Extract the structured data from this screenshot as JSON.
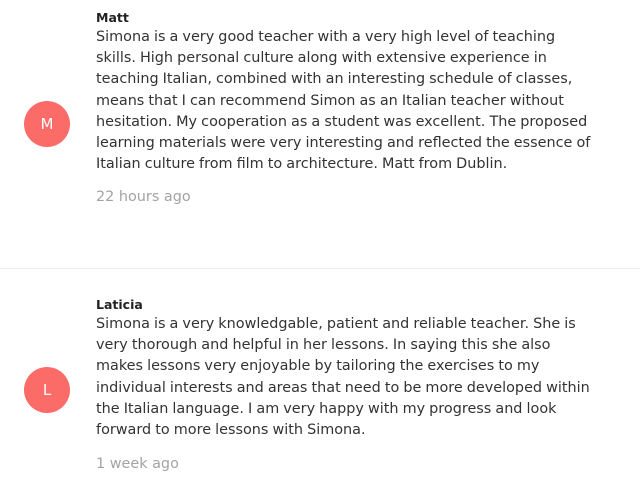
{
  "reviews": [
    {
      "avatar_letter": "M",
      "avatar_color": "#fb6b68",
      "name": "Matt",
      "text": "Simona is a very good teacher with a very high level of teaching skills. High personal culture along with extensive experience in teaching Italian, combined with an interesting schedule of classes, means that I can recommend Simon as an Italian teacher without hesitation. My cooperation as a student was excellent. The proposed learning materials were very interesting and reflected the essence of Italian culture from film to architecture. Matt from Dublin.",
      "time": "22 hours ago"
    },
    {
      "avatar_letter": "L",
      "avatar_color": "#fb6b68",
      "name": "Laticia",
      "text": "Simona is a very knowledgable, patient and reliable teacher. She is very thorough and helpful in her lessons. In saying this she also makes lessons very enjoyable by tailoring the exercises to my individual interests and areas that need to be more developed within the Italian language. I am very happy with my progress and look forward to more lessons with Simona.",
      "time": "1 week ago"
    }
  ]
}
